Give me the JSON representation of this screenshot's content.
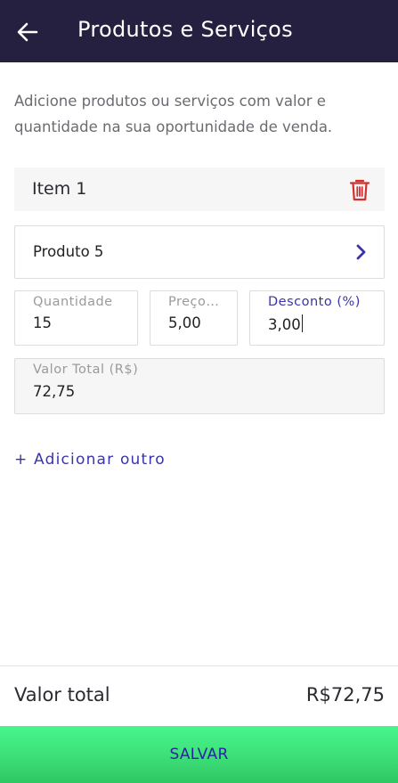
{
  "header": {
    "title": "Produtos e Serviços",
    "back_icon": "arrow-left-icon"
  },
  "intro": "Adicione produtos ou serviços com valor e quantidade na sua oportunidade de venda.",
  "item": {
    "title": "Item 1",
    "delete_icon": "trash-icon",
    "product": "Produto 5",
    "product_chevron_icon": "chevron-right-icon",
    "quantity": {
      "label": "Quantidade",
      "value": "15"
    },
    "price": {
      "label": "Preço…",
      "value": "5,00"
    },
    "discount": {
      "label": "Desconto (%)",
      "value": "3,00"
    },
    "total": {
      "label": "Valor Total (R$)",
      "value": "72,75"
    }
  },
  "add_another": "+ Adicionar outro",
  "footer": {
    "total_label": "Valor total",
    "total_value": "R$72,75"
  },
  "save_label": "SALVAR",
  "colors": {
    "appbar": "#25203f",
    "accent": "#3a34a8",
    "delete": "#d32f2f",
    "save_green": "#3fe37c"
  }
}
